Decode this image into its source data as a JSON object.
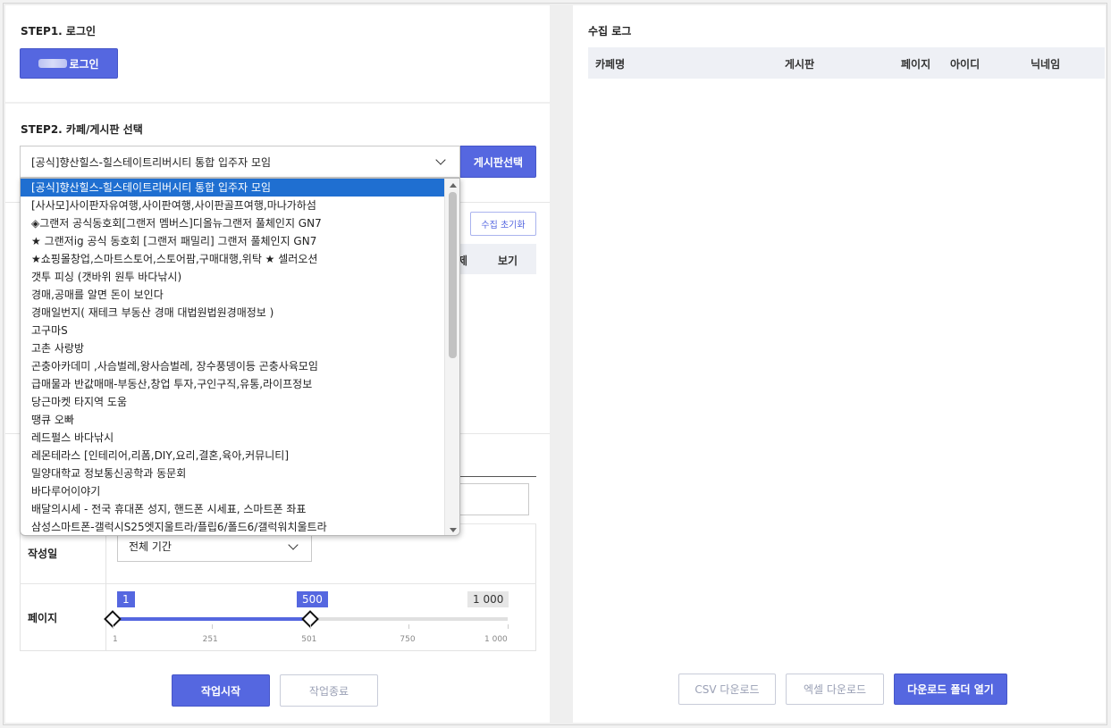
{
  "step1": {
    "title": "STEP1. 로그인",
    "login_button": "로그인"
  },
  "step2": {
    "title": "STEP2. 카페/게시판 선택",
    "selected_cafe": "[공식]향산힐스-힐스테이트리버시티 통합 입주자 모임",
    "board_button": "게시판선택",
    "options": [
      "[공식]향산힐스-힐스테이트리버시티 통합 입주자 모임",
      "[사사모]사이판자유여행,사이판여행,사이판골프여행,마나가하섬",
      "◈그랜저 공식동호회[그랜저 멤버스]디올뉴그랜저 풀체인지 GN7",
      "★ 그랜저ig 공식 동호회 [그랜저 패밀리] 그랜저 풀체인지 GN7",
      "★쇼핑몰창업,스마트스토어,스토어팜,구매대행,위탁 ★ 셀러오션",
      "갯투 피싱 (갯바위 원투 바다낚시)",
      "경매,공매를 알면 돈이 보인다",
      "경매일번지( 재테크 부동산 경매 대법원법원경매정보 )",
      "고구마S",
      "고촌 사랑방",
      "곤충아카데미 ,사슴벌레,왕사슴벌레, 장수풍뎅이등 곤충사육모임",
      "급매물과 반값매매-부동산,창업 투자,구인구직,유통,라이프정보",
      "당근마켓 타지역 도움",
      "땡큐 오빠",
      "레드펄스 바다낚시",
      "레몬테라스 [인테리어,리폼,DIY,요리,결혼,육아,커뮤니티]",
      "밀양대학교 정보통신공학과 동문회",
      "바다루어이야기",
      "배달의시세 - 전국 휴대폰 성지, 핸드폰 시세표, 스마트폰 좌표",
      "삼성스마트폰-갤럭시S25엣지울트라/플립6/폴드6/갤럭워치울트라"
    ]
  },
  "board_table": {
    "reset_button": "수집 초기화",
    "col_delete": "삭제",
    "col_view": "보기"
  },
  "filters": {
    "date_label": "작성일",
    "date_value": "전체 기간",
    "page_label": "페이지",
    "page_min": 1,
    "page_max_selected": 500,
    "page_limit": "1 000",
    "page_min_label": "1",
    "page_max_label": "500",
    "ticks": [
      "1",
      "251",
      "501",
      "750",
      "1 000"
    ]
  },
  "actions": {
    "start": "작업시작",
    "stop": "작업종료"
  },
  "log": {
    "title": "수집 로그",
    "columns": [
      "카페명",
      "게시판",
      "페이지",
      "아이디",
      "닉네임"
    ],
    "csv_button": "CSV 다운로드",
    "excel_button": "엑셀 다운로드",
    "open_folder_button": "다운로드 폴더 열기"
  },
  "colors": {
    "accent": "#5567e0",
    "selected_option": "#1f6fd1"
  }
}
